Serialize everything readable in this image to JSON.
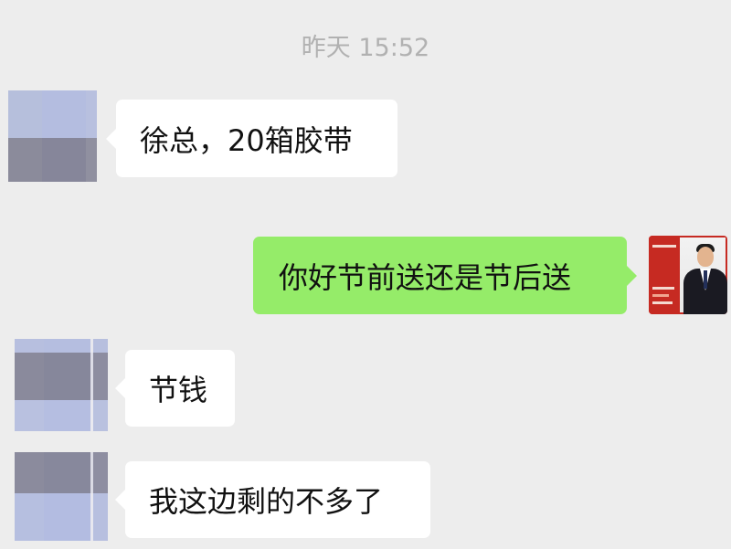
{
  "chat": {
    "timestamp": "昨天 15:52",
    "messages": [
      {
        "sender": "other",
        "text": "徐总，20箱胶带"
      },
      {
        "sender": "self",
        "text": "你好节前送还是节后送"
      },
      {
        "sender": "other",
        "text": "节钱"
      },
      {
        "sender": "other",
        "text": "我这边剩的不多了"
      }
    ]
  },
  "colors": {
    "background": "#ededed",
    "incoming_bubble": "#ffffff",
    "outgoing_bubble": "#95ec69",
    "timestamp_text": "#b1b1b1",
    "avatar_blur_light": "#b8c0df",
    "avatar_blur_dark": "#8a8a9c",
    "self_avatar_red": "#c62a22"
  },
  "icons": {
    "contact_avatar": "pixelated-avatar-icon",
    "self_avatar": "businessman-avatar-icon"
  }
}
